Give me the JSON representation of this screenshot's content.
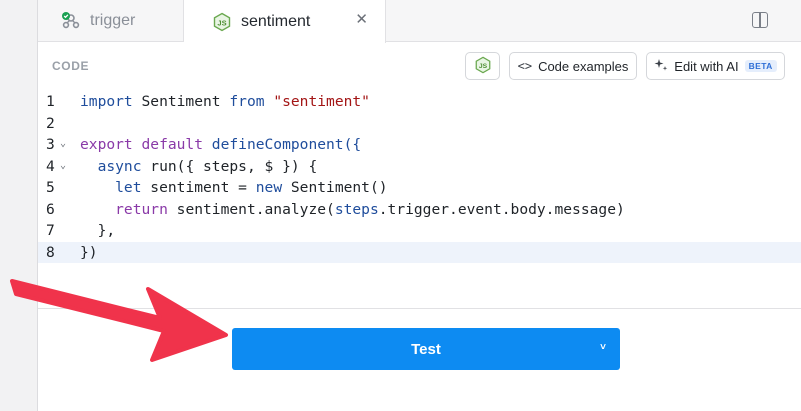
{
  "tabs": [
    {
      "label": "trigger",
      "icon": "trigger-graph-icon",
      "active": false
    },
    {
      "label": "sentiment",
      "icon": "nodejs-icon",
      "active": true,
      "close": "✕"
    }
  ],
  "toolbar": {
    "section_label": "CODE",
    "code_examples_glyph": "<>",
    "code_examples_label": "Code examples",
    "edit_ai_label": "Edit with AI",
    "beta_badge": "BETA"
  },
  "code_lines": [
    {
      "n": "1",
      "fold": false
    },
    {
      "n": "2",
      "fold": false
    },
    {
      "n": "3",
      "fold": true
    },
    {
      "n": "4",
      "fold": true
    },
    {
      "n": "5",
      "fold": false
    },
    {
      "n": "6",
      "fold": false
    },
    {
      "n": "7",
      "fold": false
    },
    {
      "n": "8",
      "fold": false,
      "active": true
    }
  ],
  "code": {
    "l1_import": "import",
    "l1_name": " Sentiment ",
    "l1_from": "from",
    "l1_str": " \"sentiment\"",
    "l3_export": "export",
    "l3_default": " default ",
    "l3_rest": "defineComponent({",
    "l4_async": "  async",
    "l4_rest": " run({ steps, $ }) {",
    "l5_let": "    let",
    "l5_mid": " sentiment = ",
    "l5_new": "new",
    "l5_rest": " Sentiment()",
    "l6_return": "    return",
    "l6_rest": " sentiment.analyze(",
    "l6_steps": "steps",
    "l6_tail": ".trigger.event.body.message)",
    "l7": "  },",
    "l8": "})"
  },
  "actions": {
    "test_label": "Test",
    "caret": "˅"
  },
  "colors": {
    "test_button": "#0d8bf2",
    "annotation_arrow": "#f0334b"
  }
}
